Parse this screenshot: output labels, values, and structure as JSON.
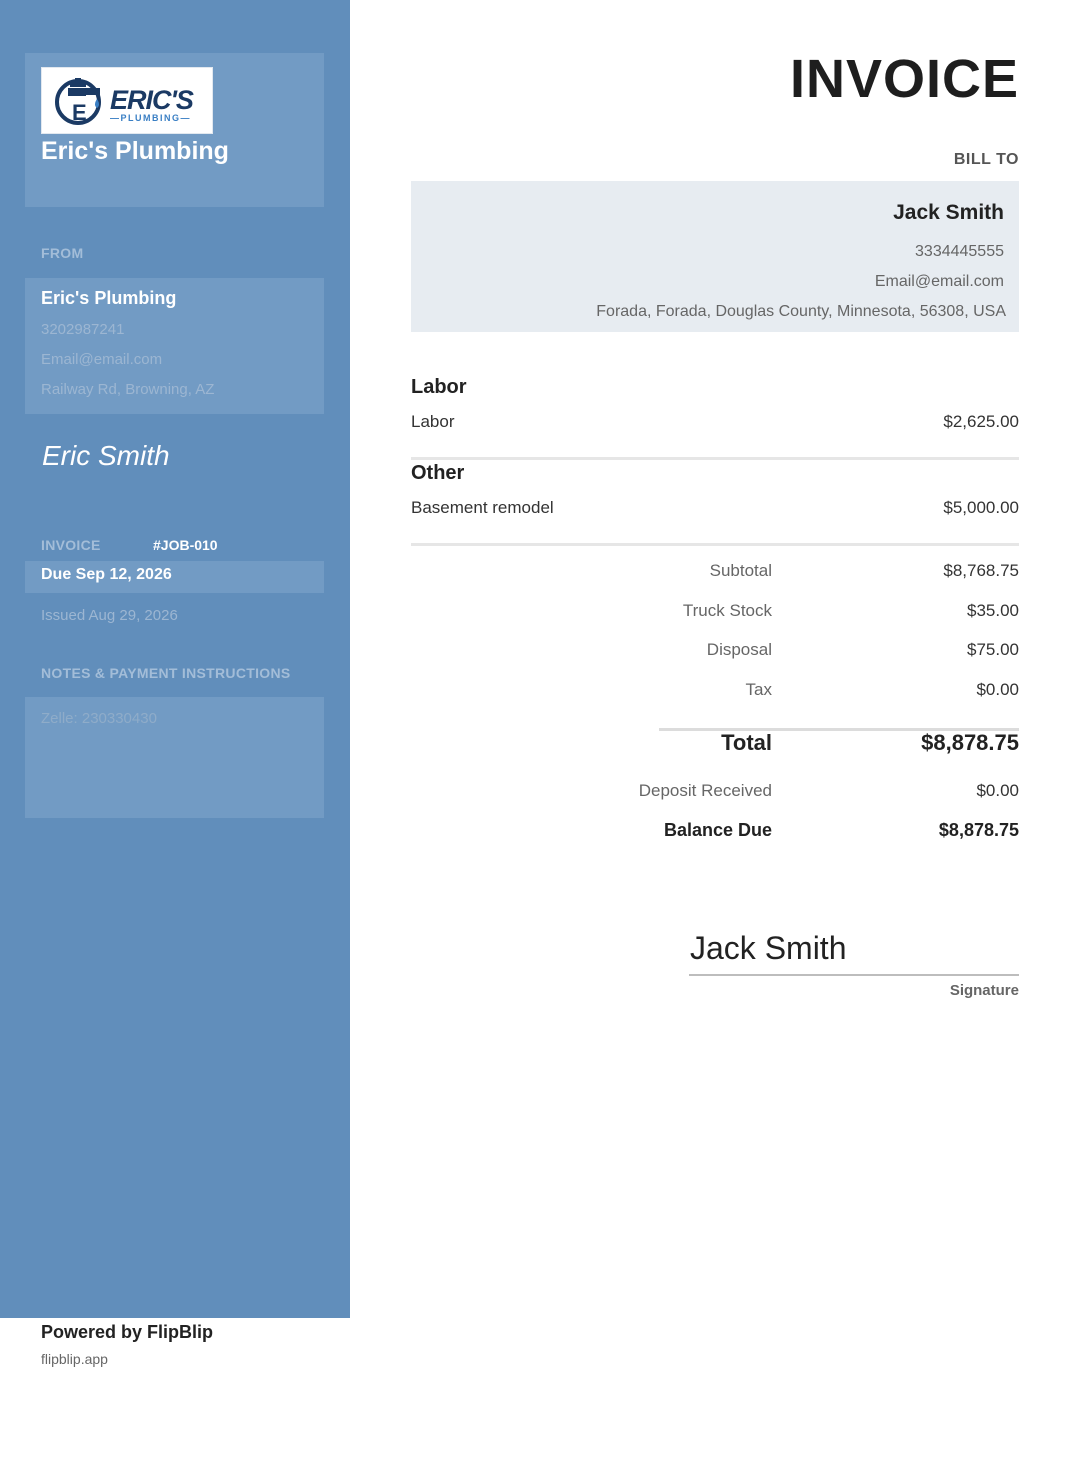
{
  "colors": {
    "sidebar": "#618ebb",
    "panel": "#729bc4",
    "bill_box": "#e7ecf1",
    "logo_navy": "#1b3a64",
    "logo_blue": "#3a7fc4"
  },
  "logo": {
    "word": "ERIC'S",
    "sub": "—PLUMBING—",
    "monogram": "E",
    "icon": "faucet-icon"
  },
  "company": {
    "name": "Eric's Plumbing",
    "from_label": "FROM",
    "from_name": "Eric's Plumbing",
    "phone": "3202987241",
    "email": "Email@email.com",
    "address": "Railway Rd, Browning, AZ",
    "sender_signature": "Eric Smith"
  },
  "invoice": {
    "title": "INVOICE",
    "label": "INVOICE",
    "number": "#JOB-010",
    "due": "Due Sep 12, 2026",
    "issued": "Issued Aug 29, 2026"
  },
  "notes": {
    "label": "NOTES & PAYMENT INSTRUCTIONS",
    "text": "Zelle: 230330430"
  },
  "bill_to": {
    "label": "BILL TO",
    "name": "Jack Smith",
    "phone": "3334445555",
    "email": "Email@email.com",
    "address": "Forada, Forada, Douglas County, Minnesota, 56308, USA"
  },
  "sections": [
    {
      "title": "Labor",
      "items": [
        {
          "desc": "Labor",
          "amount": "$2,625.00"
        }
      ]
    },
    {
      "title": "Other",
      "items": [
        {
          "desc": "Basement remodel",
          "amount": "$5,000.00"
        }
      ]
    }
  ],
  "totals": {
    "subtotal_label": "Subtotal",
    "subtotal": "$8,768.75",
    "truck_label": "Truck Stock",
    "truck": "$35.00",
    "disposal_label": "Disposal",
    "disposal": "$75.00",
    "tax_label": "Tax",
    "tax": "$0.00",
    "total_label": "Total",
    "total": "$8,878.75",
    "deposit_label": "Deposit Received",
    "deposit": "$0.00",
    "balance_label": "Balance Due",
    "balance": "$8,878.75"
  },
  "signature": {
    "name": "Jack Smith",
    "label": "Signature"
  },
  "footer": {
    "powered": "Powered by FlipBlip",
    "url": "flipblip.app"
  }
}
